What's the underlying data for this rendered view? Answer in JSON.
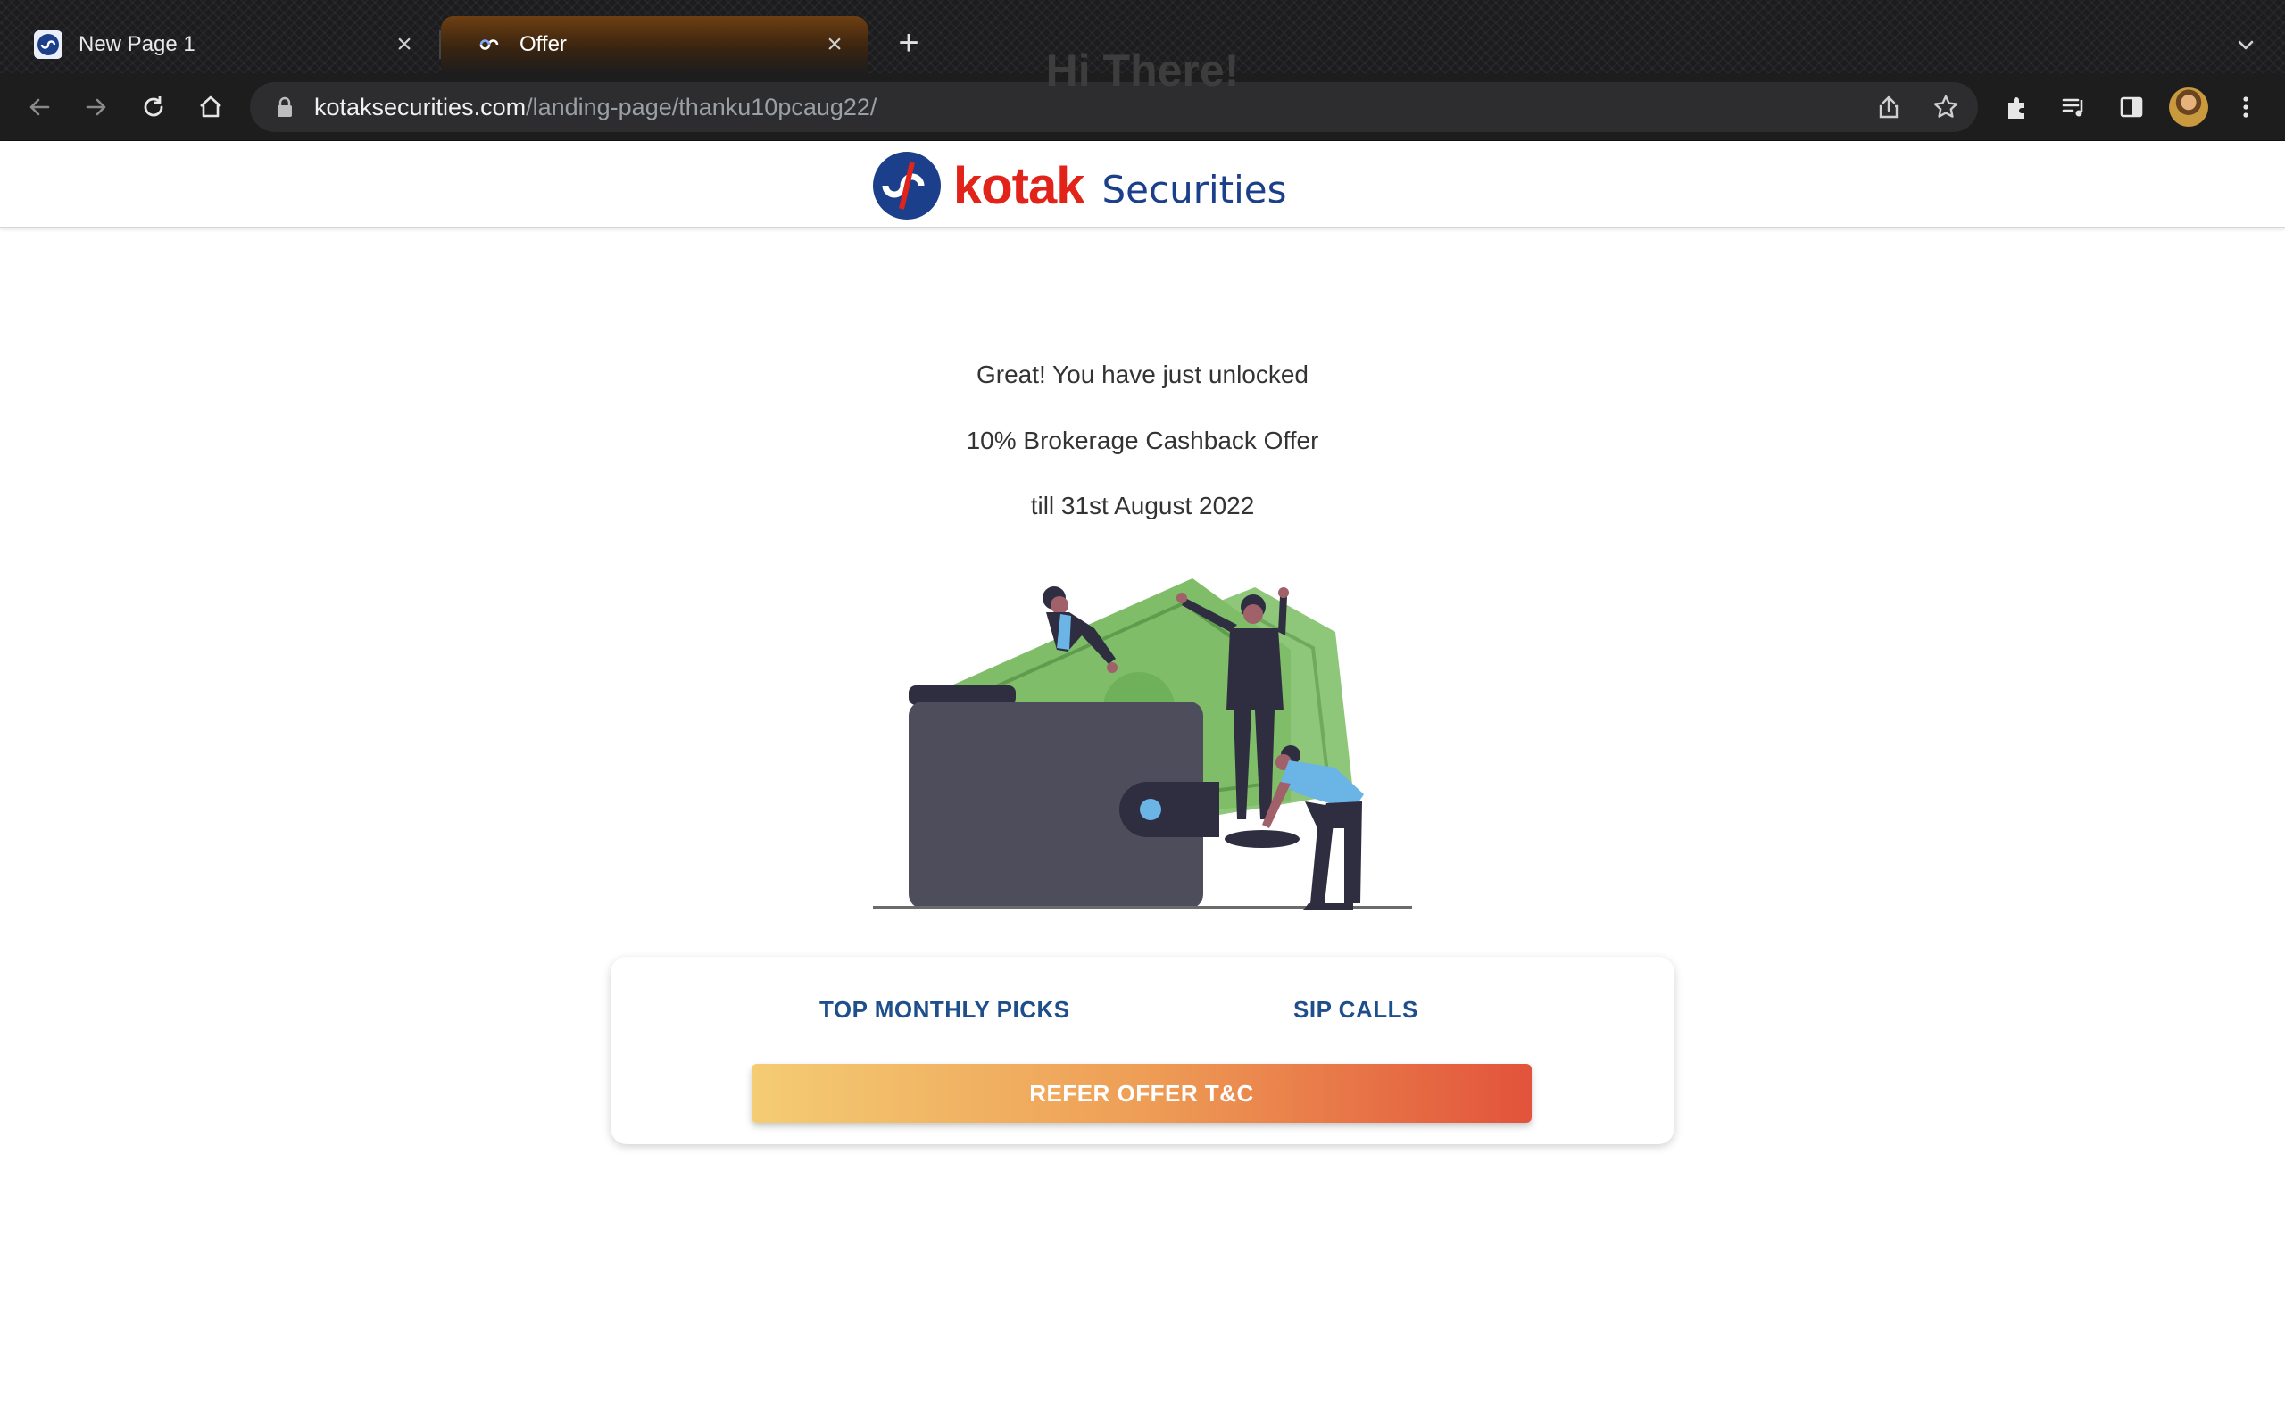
{
  "browser": {
    "tabs": [
      {
        "title": "New Page 1",
        "active": false
      },
      {
        "title": "Offer",
        "active": true
      }
    ],
    "url_host": "kotaksecurities.com",
    "url_path": "/landing-page/thanku10pcaug22/",
    "icons": {
      "back": "arrow-left-icon",
      "forward": "arrow-right-icon",
      "reload": "reload-icon",
      "home": "home-icon",
      "lock": "lock-icon",
      "share": "share-icon",
      "bookmark": "star-icon",
      "extensions": "puzzle-icon",
      "media": "media-queue-icon",
      "sidepanel": "side-panel-icon",
      "menu": "kebab-menu-icon",
      "new_tab": "plus-icon",
      "close_tab": "close-icon",
      "tab_list": "chevron-down-icon"
    }
  },
  "header": {
    "brand": "kotak",
    "brand_suffix": "Securities",
    "colors": {
      "brand_red": "#e2231a",
      "brand_blue": "#1b3f8b"
    }
  },
  "main": {
    "greeting": "Hi There!",
    "line1": "Great! You have just unlocked",
    "line2": "10% Brokerage Cashback Offer",
    "line3": "till 31st August 2022"
  },
  "card": {
    "link_picks": "TOP MONTHLY PICKS",
    "link_sip": "SIP CALLS",
    "cta_label": "REFER OFFER T&C",
    "colors": {
      "link": "#1f4e8c",
      "cta_start": "#f4cc73",
      "cta_end": "#e2533b"
    }
  }
}
